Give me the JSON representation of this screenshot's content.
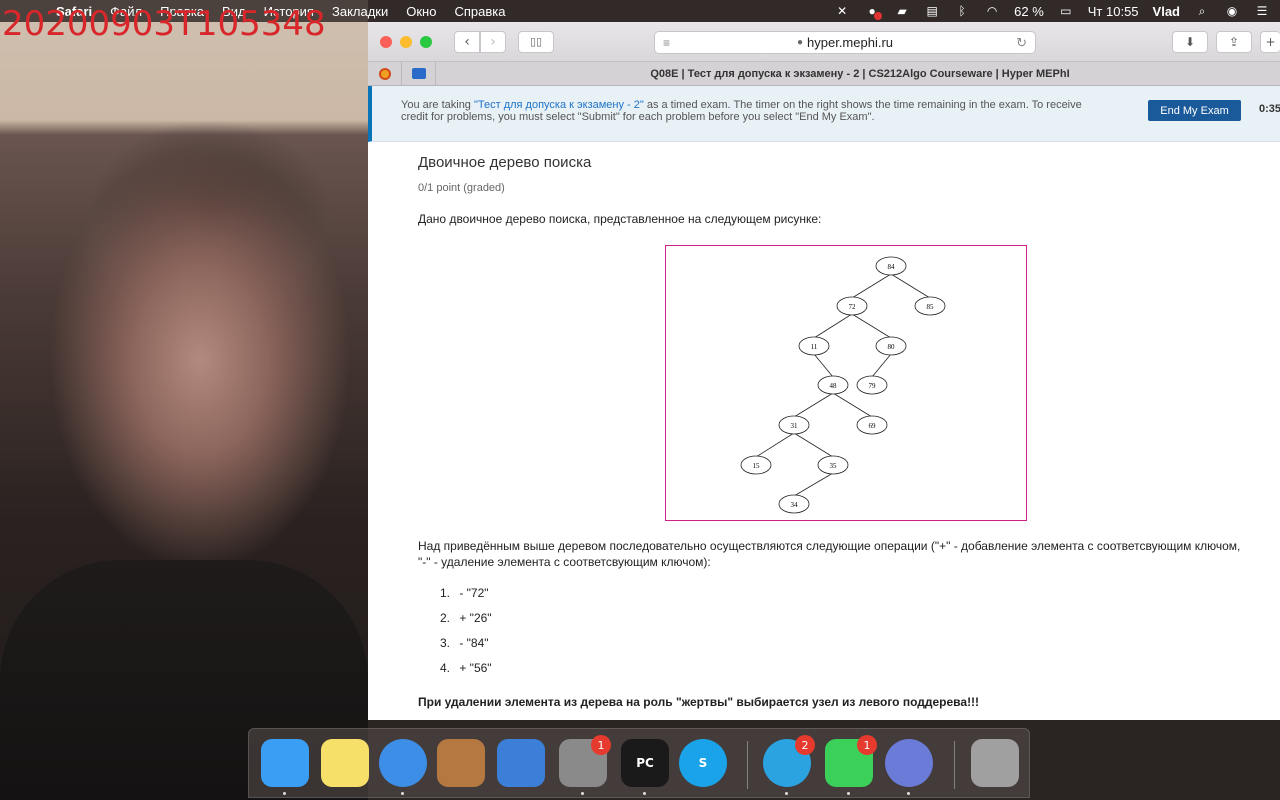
{
  "overlay": {
    "stamp": "20200903T105348"
  },
  "menubar": {
    "app": "Safari",
    "items": [
      "Файл",
      "Правка",
      "Вид",
      "История",
      "Закладки",
      "Окно",
      "Справка"
    ],
    "battery": "62 %",
    "clock": "Чт 10:55",
    "user": "Vlad"
  },
  "browser": {
    "address": "hyper.mephi.ru",
    "tab_title": "Q08E | Тест для допуска к экзамену - 2 | CS212Algo Courseware | Hyper MEPhI"
  },
  "exam_banner": {
    "text_before": "You are taking ",
    "exam_link": "\"Тест для допуска к экзамену - 2\"",
    "text_after": " as a timed exam. The timer on the right shows the time remaining in the exam. To receive credit for problems, you must select \"Submit\" for each problem before you select \"End My Exam\".",
    "end_button": "End My Exam",
    "timer": "0:35:"
  },
  "problem": {
    "title": "Двоичное дерево поиска",
    "points": "0/1 point (graded)",
    "intro": "Дано двоичное дерево поиска, представленное на следующем рисунке:",
    "ops_intro": "Над приведённым выше деревом последовательно осуществляются следующие операции (\"+\" - добавление элемента с соответсвующим ключом, \"-\" - удаление элемента с соответсвующим ключом):",
    "operations": [
      {
        "num": "1.",
        "op": "- \"72\""
      },
      {
        "num": "2.",
        "op": "+ \"26\""
      },
      {
        "num": "3.",
        "op": "- \"84\""
      },
      {
        "num": "4.",
        "op": "+ \"56\""
      }
    ],
    "note": "При удалении элемента из дерева на роль \"жертвы\" выбирается узел из левого поддерева!!!"
  },
  "tree": {
    "nodes": [
      {
        "id": "84",
        "label": "84"
      },
      {
        "id": "72",
        "label": "72"
      },
      {
        "id": "85",
        "label": "85"
      },
      {
        "id": "11",
        "label": "11"
      },
      {
        "id": "80",
        "label": "80"
      },
      {
        "id": "48",
        "label": "48"
      },
      {
        "id": "79",
        "label": "79"
      },
      {
        "id": "31",
        "label": "31"
      },
      {
        "id": "69",
        "label": "69"
      },
      {
        "id": "15",
        "label": "15"
      },
      {
        "id": "35",
        "label": "35"
      },
      {
        "id": "34",
        "label": "34"
      }
    ],
    "edges": [
      [
        "84",
        "72"
      ],
      [
        "84",
        "85"
      ],
      [
        "72",
        "11"
      ],
      [
        "72",
        "80"
      ],
      [
        "11",
        "48"
      ],
      [
        "80",
        "79"
      ],
      [
        "48",
        "31"
      ],
      [
        "48",
        "69"
      ],
      [
        "31",
        "15"
      ],
      [
        "31",
        "35"
      ],
      [
        "35",
        "34"
      ]
    ]
  },
  "dock": {
    "apps": [
      {
        "name": "finder",
        "label": "",
        "color": "#3a9ef5",
        "badge": ""
      },
      {
        "name": "notes",
        "label": "",
        "color": "#f7e06a",
        "badge": ""
      },
      {
        "name": "safari",
        "label": "",
        "color": "#3d8ee6",
        "badge": ""
      },
      {
        "name": "garageband",
        "label": "",
        "color": "#b57840",
        "badge": ""
      },
      {
        "name": "xcode",
        "label": "",
        "color": "#3c7fd8",
        "badge": ""
      },
      {
        "name": "system-preferences",
        "label": "",
        "color": "#8a8a8a",
        "badge": "1"
      },
      {
        "name": "pycharm",
        "label": "PC",
        "color": "#1a1a1a",
        "badge": ""
      },
      {
        "name": "skype",
        "label": "S",
        "color": "#1aa3e8",
        "badge": ""
      },
      {
        "name": "telegram",
        "label": "",
        "color": "#2aa3e0",
        "badge": "2"
      },
      {
        "name": "facetime",
        "label": "",
        "color": "#3ad05a",
        "badge": "1"
      },
      {
        "name": "discord",
        "label": "",
        "color": "#6b7bd8",
        "badge": ""
      },
      {
        "name": "trash",
        "label": "",
        "color": "#a0a0a0",
        "badge": ""
      }
    ]
  }
}
